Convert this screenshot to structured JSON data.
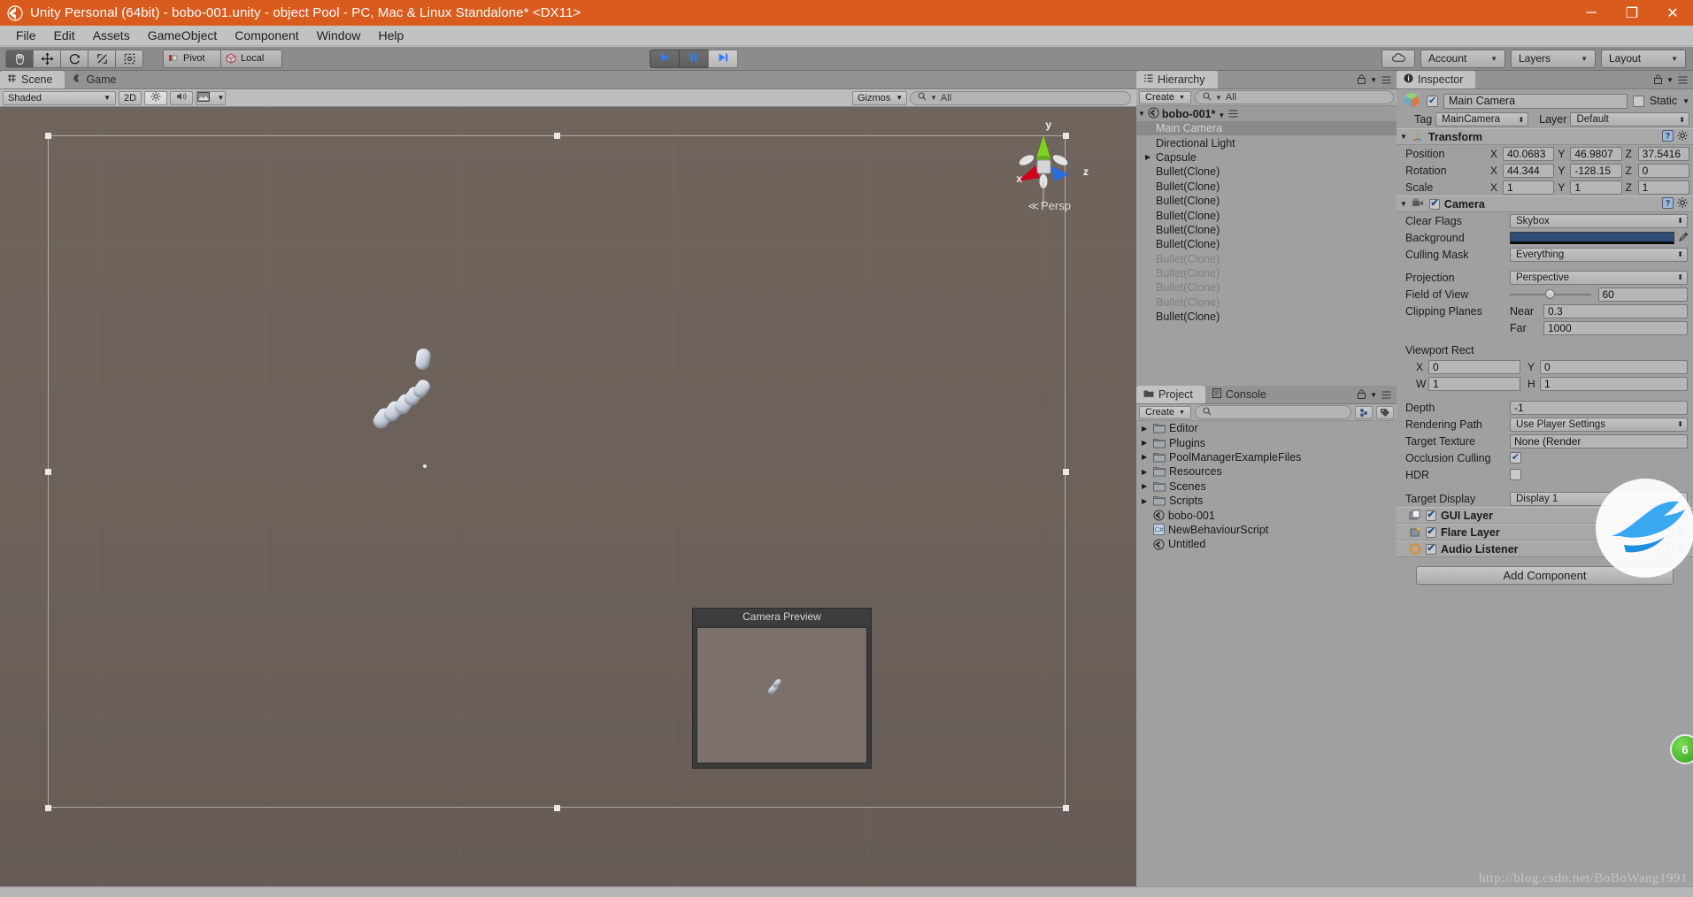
{
  "window": {
    "title": "Unity Personal (64bit) - bobo-001.unity - object Pool - PC, Mac & Linux Standalone* <DX11>",
    "logo_icon": "unity-logo-icon",
    "minimize": "─",
    "maximize": "❐",
    "close": "✕",
    "titlebar_color": "#d95b1e"
  },
  "menubar": {
    "items": [
      {
        "label": "File"
      },
      {
        "label": "Edit"
      },
      {
        "label": "Assets"
      },
      {
        "label": "GameObject"
      },
      {
        "label": "Component"
      },
      {
        "label": "Window"
      },
      {
        "label": "Help"
      }
    ]
  },
  "toolbar": {
    "transform_tools": [
      {
        "name": "hand-tool",
        "icon": "hand-icon",
        "active": true
      },
      {
        "name": "move-tool",
        "icon": "move-arrows-icon",
        "active": false
      },
      {
        "name": "rotate-tool",
        "icon": "rotate-icon",
        "active": false
      },
      {
        "name": "scale-tool",
        "icon": "scale-icon",
        "active": false
      },
      {
        "name": "rect-tool",
        "icon": "rect-transform-icon",
        "active": false
      }
    ],
    "pivot_label": "Pivot",
    "local_label": "Local",
    "play_label": "play-icon",
    "pause_label": "pause-icon",
    "step_label": "step-icon",
    "cloud_label": "cloud-icon",
    "account_label": "Account",
    "layers_label": "Layers",
    "layout_label": "Layout"
  },
  "scene": {
    "tabs": [
      {
        "label": "Scene",
        "icon": "grid-icon",
        "selected": true
      },
      {
        "label": "Game",
        "icon": "gamepad-icon",
        "selected": false
      }
    ],
    "draw_mode": "Shaded",
    "mode_2d": "2D",
    "toggles": [
      "light-icon",
      "audio-icon",
      "fx-icon"
    ],
    "gizmos_label": "Gizmos",
    "search_placeholder": "All",
    "search_value": "All",
    "persp_label": "Persp",
    "axis_x": "x",
    "axis_y": "y",
    "axis_z": "z",
    "camera_preview_title": "Camera Preview"
  },
  "hierarchy": {
    "tab_label": "Hierarchy",
    "tab_icon": "hierarchy-icon",
    "create_label": "Create",
    "search_value": "All",
    "scene_name": "bobo-001*",
    "items": [
      {
        "label": "Main Camera",
        "selected": true,
        "dim": false,
        "expandable": false
      },
      {
        "label": "Directional Light",
        "selected": false,
        "dim": false,
        "expandable": false
      },
      {
        "label": "Capsule",
        "selected": false,
        "dim": false,
        "expandable": true
      },
      {
        "label": "Bullet(Clone)",
        "selected": false,
        "dim": false,
        "expandable": false
      },
      {
        "label": "Bullet(Clone)",
        "selected": false,
        "dim": false,
        "expandable": false
      },
      {
        "label": "Bullet(Clone)",
        "selected": false,
        "dim": false,
        "expandable": false
      },
      {
        "label": "Bullet(Clone)",
        "selected": false,
        "dim": false,
        "expandable": false
      },
      {
        "label": "Bullet(Clone)",
        "selected": false,
        "dim": false,
        "expandable": false
      },
      {
        "label": "Bullet(Clone)",
        "selected": false,
        "dim": false,
        "expandable": false
      },
      {
        "label": "Bullet(Clone)",
        "selected": false,
        "dim": true,
        "expandable": false
      },
      {
        "label": "Bullet(Clone)",
        "selected": false,
        "dim": true,
        "expandable": false
      },
      {
        "label": "Bullet(Clone)",
        "selected": false,
        "dim": true,
        "expandable": false
      },
      {
        "label": "Bullet(Clone)",
        "selected": false,
        "dim": true,
        "expandable": false
      },
      {
        "label": "Bullet(Clone)",
        "selected": false,
        "dim": false,
        "expandable": false
      }
    ]
  },
  "project": {
    "tabs": [
      {
        "label": "Project",
        "icon": "folder-icon",
        "selected": true
      },
      {
        "label": "Console",
        "icon": "console-icon",
        "selected": false
      }
    ],
    "create_label": "Create",
    "search_value": "",
    "items": [
      {
        "label": "Editor",
        "type": "folder"
      },
      {
        "label": "Plugins",
        "type": "folder"
      },
      {
        "label": "PoolManagerExampleFiles",
        "type": "folder"
      },
      {
        "label": "Resources",
        "type": "folder"
      },
      {
        "label": "Scenes",
        "type": "folder"
      },
      {
        "label": "Scripts",
        "type": "folder"
      },
      {
        "label": "bobo-001",
        "type": "scene"
      },
      {
        "label": "NewBehaviourScript",
        "type": "script"
      },
      {
        "label": "Untitled",
        "type": "scene"
      }
    ]
  },
  "inspector": {
    "tab_label": "Inspector",
    "tab_icon": "info-icon",
    "object_name": "Main Camera",
    "object_enabled": true,
    "static_label": "Static",
    "static_checked": false,
    "tag_label": "Tag",
    "tag_value": "MainCamera",
    "layer_label": "Layer",
    "layer_value": "Default",
    "transform": {
      "title": "Transform",
      "icon": "transform-icon",
      "rows": [
        {
          "label": "Position",
          "x": "40.0683",
          "y": "46.9807",
          "z": "37.5416"
        },
        {
          "label": "Rotation",
          "x": "44.344",
          "y": "-128.15",
          "z": "0"
        },
        {
          "label": "Scale",
          "x": "1",
          "y": "1",
          "z": "1"
        }
      ]
    },
    "camera": {
      "title": "Camera",
      "icon": "camera-icon",
      "enabled": true,
      "clear_flags_label": "Clear Flags",
      "clear_flags_value": "Skybox",
      "background_label": "Background",
      "background_color": "#2f4d76",
      "culling_mask_label": "Culling Mask",
      "culling_mask_value": "Everything",
      "projection_label": "Projection",
      "projection_value": "Perspective",
      "fov_label": "Field of View",
      "fov_value": "60",
      "clipping_label": "Clipping Planes",
      "near_label": "Near",
      "near_value": "0.3",
      "far_label": "Far",
      "far_value": "1000",
      "viewport_label": "Viewport Rect",
      "viewport_x_label": "X",
      "viewport_x": "0",
      "viewport_y_label": "Y",
      "viewport_y": "0",
      "viewport_w_label": "W",
      "viewport_w": "1",
      "viewport_h_label": "H",
      "viewport_h": "1",
      "depth_label": "Depth",
      "depth_value": "-1",
      "rendering_path_label": "Rendering Path",
      "rendering_path_value": "Use Player Settings",
      "target_texture_label": "Target Texture",
      "target_texture_value": "None (Render",
      "occlusion_label": "Occlusion Culling",
      "occlusion_checked": true,
      "hdr_label": "HDR",
      "hdr_checked": false,
      "target_display_label": "Target Display",
      "target_display_value": "Display 1"
    },
    "components": [
      {
        "label": "GUI Layer",
        "icon": "gui-layer-icon",
        "enabled": true
      },
      {
        "label": "Flare Layer",
        "icon": "flare-layer-icon",
        "enabled": true
      },
      {
        "label": "Audio Listener",
        "icon": "audio-listener-icon",
        "enabled": true
      }
    ],
    "add_component_label": "Add Component"
  },
  "overlay": {
    "watermark": "http://blog.csdn.net/BoBoWang1991",
    "badge_text": "6",
    "bird_icon": "bird-watermark-icon"
  },
  "statusbar": {
    "text": ""
  }
}
